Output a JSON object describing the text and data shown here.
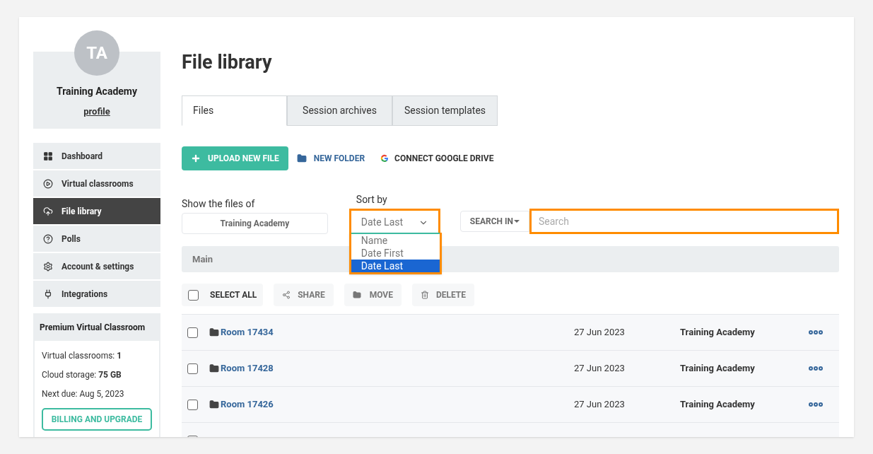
{
  "profile": {
    "initials": "TA",
    "name": "Training Academy",
    "link": "profile"
  },
  "nav": [
    {
      "label": "Dashboard",
      "selected": false
    },
    {
      "label": "Virtual classrooms",
      "selected": false
    },
    {
      "label": "File library",
      "selected": true
    },
    {
      "label": "Polls",
      "selected": false
    },
    {
      "label": "Account & settings",
      "selected": false
    },
    {
      "label": "Integrations",
      "selected": false
    }
  ],
  "plan": {
    "title": "Premium Virtual Classroom",
    "lines": [
      "Virtual classrooms: **1**",
      "Cloud storage: **75 GB**",
      "Next due: Aug 5, 2023"
    ],
    "button": "BILLING AND UPGRADE"
  },
  "title": "File library",
  "tabs": [
    {
      "label": "Files",
      "selected": true
    },
    {
      "label": "Session archives",
      "selected": false
    },
    {
      "label": "Session templates",
      "selected": false
    }
  ],
  "actions": {
    "upload": "UPLOAD NEW FILE",
    "folder": "NEW FOLDER",
    "drive": "CONNECT GOOGLE DRIVE"
  },
  "owner": {
    "label": "Show the files of",
    "value": "Training Academy"
  },
  "sort": {
    "label": "Sort by",
    "value": "Date Last",
    "highlighted": true,
    "expanded": true,
    "options": [
      {
        "label": "Name",
        "selected": false
      },
      {
        "label": "Date First",
        "selected": false
      },
      {
        "label": "Date Last",
        "selected": true
      }
    ]
  },
  "search": {
    "scope": "SEARCH IN",
    "placeholder": "Search",
    "highlighted": true
  },
  "breadcrumb": "Main",
  "toolbar": {
    "select_all": "SELECT ALL",
    "checked": false,
    "share": "SHARE",
    "move": "MOVE",
    "delete": "DELETE"
  },
  "rows": [
    {
      "name": "Room 17434",
      "date": "27 Jun 2023",
      "owner": "Training Academy",
      "checked": false
    },
    {
      "name": "Room 17428",
      "date": "27 Jun 2023",
      "owner": "Training Academy",
      "checked": false
    },
    {
      "name": "Room 17426",
      "date": "27 Jun 2023",
      "owner": "Training Academy",
      "checked": false
    }
  ],
  "partial_row": {
    "checked": false
  }
}
